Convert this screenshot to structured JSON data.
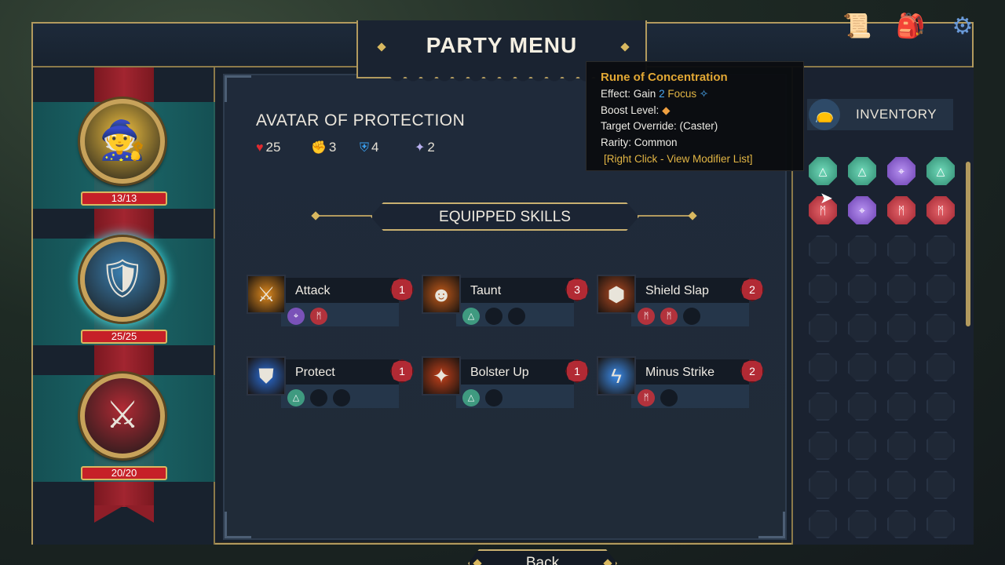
{
  "header": {
    "title": "PARTY MENU"
  },
  "top_icons": [
    {
      "name": "map-scroll-icon",
      "glyph": "📜"
    },
    {
      "name": "backpack-icon",
      "glyph": "🎒"
    },
    {
      "name": "settings-gear-icon",
      "glyph": "⚙"
    }
  ],
  "roster": {
    "heroes": [
      {
        "hp": "13/13",
        "portrait_color": "#f0c040",
        "glyph": "🧙"
      },
      {
        "hp": "25/25",
        "portrait_color": "#3a7fb0",
        "glyph": "🛡"
      },
      {
        "hp": "20/20",
        "portrait_color": "#b02a34",
        "glyph": "⚔"
      }
    ]
  },
  "hero": {
    "name": "AVATAR OF PROTECTION",
    "stats": {
      "health": "25",
      "strength": "3",
      "defense": "4",
      "focus": "2"
    }
  },
  "skills": {
    "header": "EQUIPPED SKILLS",
    "items": [
      {
        "name": "Attack",
        "level": "1",
        "glyph": "⚔",
        "color": "#e08a1e",
        "slots": [
          "purple",
          "red"
        ]
      },
      {
        "name": "Taunt",
        "level": "3",
        "glyph": "☻",
        "color": "#c25a1a",
        "slots": [
          "green",
          "empty",
          "empty"
        ]
      },
      {
        "name": "Shield Slap",
        "level": "2",
        "glyph": "⬢",
        "color": "#b24a22",
        "slots": [
          "red",
          "red",
          "empty"
        ]
      },
      {
        "name": "Protect",
        "level": "1",
        "glyph": "⛊",
        "color": "#2a6ed8",
        "slots": [
          "green",
          "empty",
          "empty"
        ]
      },
      {
        "name": "Bolster Up",
        "level": "1",
        "glyph": "✦",
        "color": "#c2401a",
        "slots": [
          "green",
          "empty"
        ]
      },
      {
        "name": "Minus Strike",
        "level": "2",
        "glyph": "ϟ",
        "color": "#3a8ae8",
        "slots": [
          "red",
          "empty"
        ]
      }
    ]
  },
  "back_button": {
    "label": "Back"
  },
  "inventory": {
    "title": "INVENTORY",
    "runes": [
      "green",
      "green",
      "purple",
      "green",
      "red",
      "purple",
      "red",
      "red"
    ],
    "empty_slots": 32
  },
  "tooltip": {
    "title": "Rune of Concentration",
    "effect_prefix": "Effect: Gain",
    "effect_amount": "2",
    "effect_stat": "Focus",
    "boost_label": "Boost Level:",
    "target_override": "Target Override: (Caster)",
    "rarity": "Rarity: Common",
    "hint": "[Right Click - View Modifier List]"
  }
}
